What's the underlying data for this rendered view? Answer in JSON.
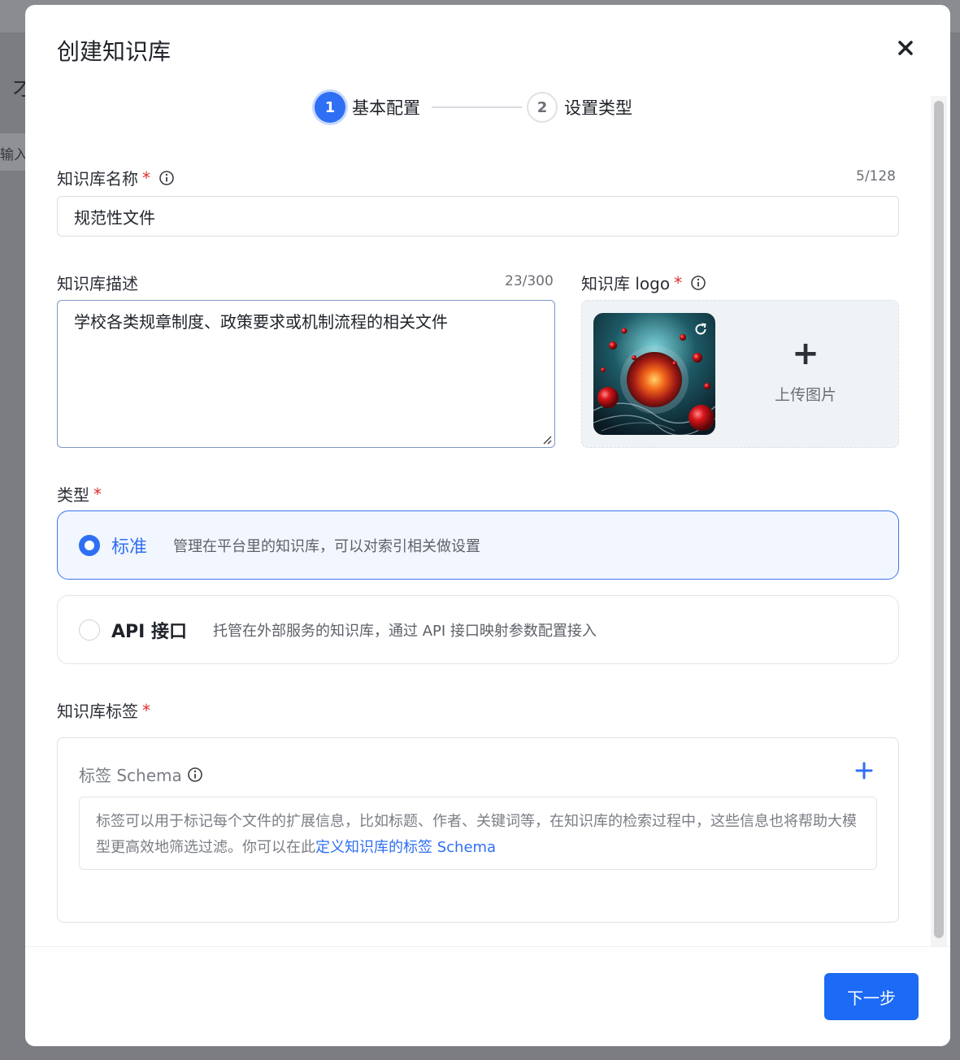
{
  "background": {
    "title_fragment": "才",
    "input_fragment": "输入"
  },
  "modal": {
    "title": "创建知识库",
    "close_icon": "close-icon"
  },
  "steps": [
    {
      "number": "1",
      "label": "基本配置",
      "active": true
    },
    {
      "number": "2",
      "label": "设置类型",
      "active": false
    }
  ],
  "name_field": {
    "label": "知识库名称",
    "required": "*",
    "counter": "5/128",
    "value": "规范性文件"
  },
  "desc_field": {
    "label": "知识库描述",
    "counter": "23/300",
    "value": "学校各类规章制度、政策要求或机制流程的相关文件"
  },
  "logo_field": {
    "label": "知识库 logo",
    "required": "*",
    "upload_label": "上传图片",
    "refresh_icon": "refresh-icon"
  },
  "type_field": {
    "label": "类型",
    "required": "*",
    "options": [
      {
        "title": "标准",
        "desc": "管理在平台里的知识库，可以对索引相关做设置",
        "selected": true
      },
      {
        "title": "API 接口",
        "desc": "托管在外部服务的知识库，通过 API 接口映射参数配置接入",
        "selected": false
      }
    ]
  },
  "tags_field": {
    "label": "知识库标签",
    "required": "*",
    "schema_label": "标签 Schema",
    "hint_text": "标签可以用于标记每个文件的扩展信息，比如标题、作者、关键词等，在知识库的检索过程中，这些信息也将帮助大模型更高效地筛选过滤。你可以在此",
    "hint_link": "定义知识库的标签 Schema"
  },
  "footer": {
    "next_label": "下一步"
  },
  "colors": {
    "accent": "#2f6ff4",
    "required": "#e02e2e",
    "button": "#1d6af5"
  }
}
